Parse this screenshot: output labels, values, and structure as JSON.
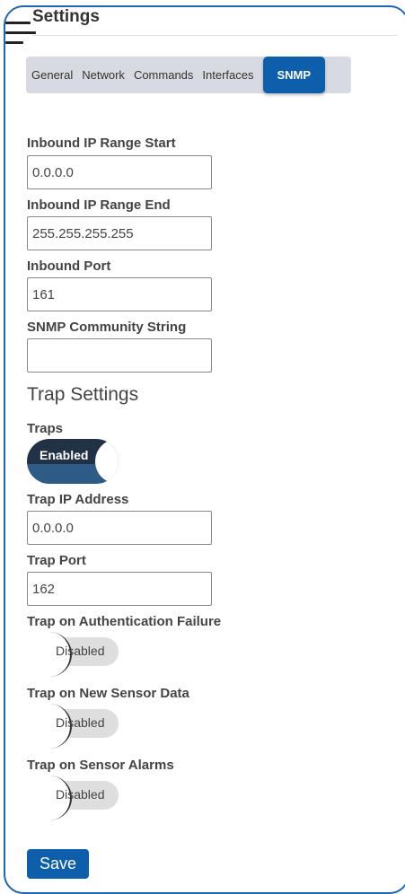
{
  "header": {
    "title": "Settings"
  },
  "tabs": [
    {
      "label": "General"
    },
    {
      "label": "Network"
    },
    {
      "label": "Commands"
    },
    {
      "label": "Interfaces"
    },
    {
      "label": "SNMP",
      "active": true
    }
  ],
  "fields": {
    "inbound_start": {
      "label": "Inbound IP Range Start",
      "value": "0.0.0.0"
    },
    "inbound_end": {
      "label": "Inbound IP Range End",
      "value": "255.255.255.255"
    },
    "inbound_port": {
      "label": "Inbound Port",
      "value": "161"
    },
    "community": {
      "label": "SNMP Community String",
      "value": ""
    }
  },
  "trap_section": {
    "title": "Trap Settings",
    "traps": {
      "label": "Traps",
      "state": "Enabled"
    },
    "trap_ip": {
      "label": "Trap IP Address",
      "value": "0.0.0.0"
    },
    "trap_port": {
      "label": "Trap Port",
      "value": "162"
    },
    "auth_failure": {
      "label": "Trap on Authentication Failure",
      "state": "Disabled"
    },
    "new_sensor": {
      "label": "Trap on New Sensor Data",
      "state": "Disabled"
    },
    "sensor_alarms": {
      "label": "Trap on Sensor Alarms",
      "state": "Disabled"
    }
  },
  "actions": {
    "save_label": "Save"
  },
  "colors": {
    "accent": "#0d5fab",
    "frame": "#1f66b3",
    "toggle_on": "#213246"
  }
}
